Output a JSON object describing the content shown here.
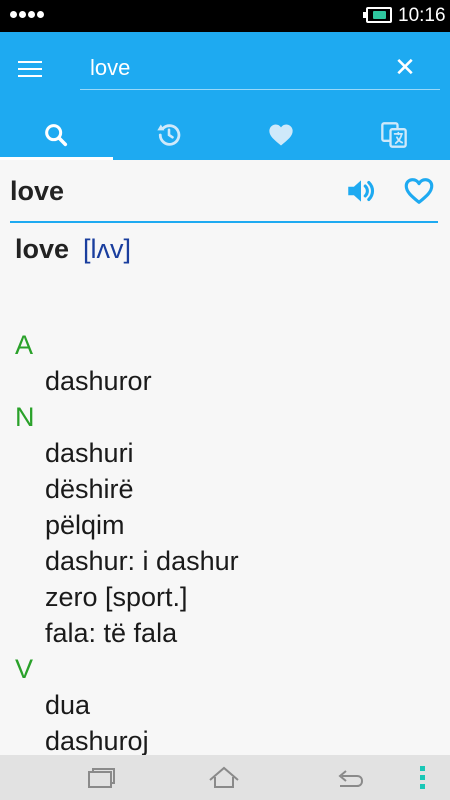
{
  "status": {
    "time": "10:16"
  },
  "search": {
    "value": "love"
  },
  "tabs": [
    {
      "name": "search",
      "icon": "search-icon",
      "active": true
    },
    {
      "name": "history",
      "icon": "history-icon",
      "active": false
    },
    {
      "name": "favorites",
      "icon": "heart-icon",
      "active": false
    },
    {
      "name": "translate",
      "icon": "translate-icon",
      "active": false
    }
  ],
  "word": {
    "title": "love",
    "headword": "love",
    "pronunciation": "[lʌv]"
  },
  "definitions": [
    {
      "pos": "A",
      "meanings": [
        "dashuror"
      ]
    },
    {
      "pos": "N",
      "meanings": [
        "dashuri",
        "dëshirë",
        "pëlqim",
        "dashur: i dashur",
        "zero [sport.]",
        "fala: të fala"
      ]
    },
    {
      "pos": "V",
      "meanings": [
        "dua",
        "dashuroj"
      ]
    }
  ],
  "colors": {
    "accent": "#1eaaf1",
    "pos": "#2aa12a",
    "pronunciation": "#1a3e9e",
    "nav_menu": "#19c7b6"
  }
}
